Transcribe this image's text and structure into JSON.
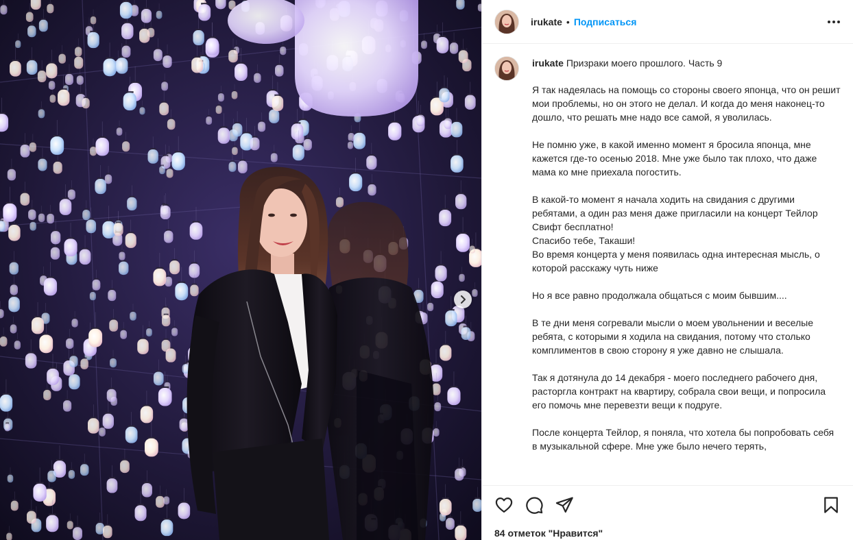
{
  "post": {
    "username": "irukate",
    "separator": "•",
    "follow_label": "Подписаться",
    "caption_title": "Призраки моего прошлого. Часть 9",
    "caption_paragraphs": [
      "Я так надеялась на помощь со стороны своего японца, что он решит мои проблемы, но он этого не делал. И когда до меня наконец-то дошло, что решать мне надо все самой, я уволилась.",
      "Не помню уже, в какой именно момент я бросила японца, мне кажется где-то осенью 2018. Мне уже было так плохо, что даже мама ко мне приехала погостить.",
      "В какой-то момент я начала ходить на свидания с другими ребятами, а один раз меня даже пригласили на концерт Тейлор Свифт бесплатно!\nСпасибо тебе, Такаши!\nВо время концерта у меня появилась одна интересная мысль, о которой расскажу чуть ниже",
      "Но я все равно продолжала общаться с моим бывшим....",
      "В те дни меня согревали мысли о моем увольнении и веселые ребята, с которыми я ходила на свидания, потому что столько комплиментов в свою сторону я уже давно не слышала.",
      "Так я дотянула до 14 декабря - моего последнего рабочего дня, расторгла контракт на квартиру, собрала свои вещи, и попросила его помочь мне перевезти вещи к подруге.",
      "После концерта Тейлор, я поняла, что хотела бы попробовать себя в музыкальной сфере. Мне уже было нечего терять,"
    ],
    "likes_text": "84 отметок \"Нравится\""
  },
  "icons": {
    "more": "more-options-icon",
    "like": "heart-icon",
    "comment": "comment-icon",
    "share": "paper-plane-icon",
    "save": "bookmark-icon",
    "next": "chevron-right-icon"
  },
  "colors": {
    "accent": "#0095f6",
    "text": "#262626",
    "border": "#efefef"
  }
}
